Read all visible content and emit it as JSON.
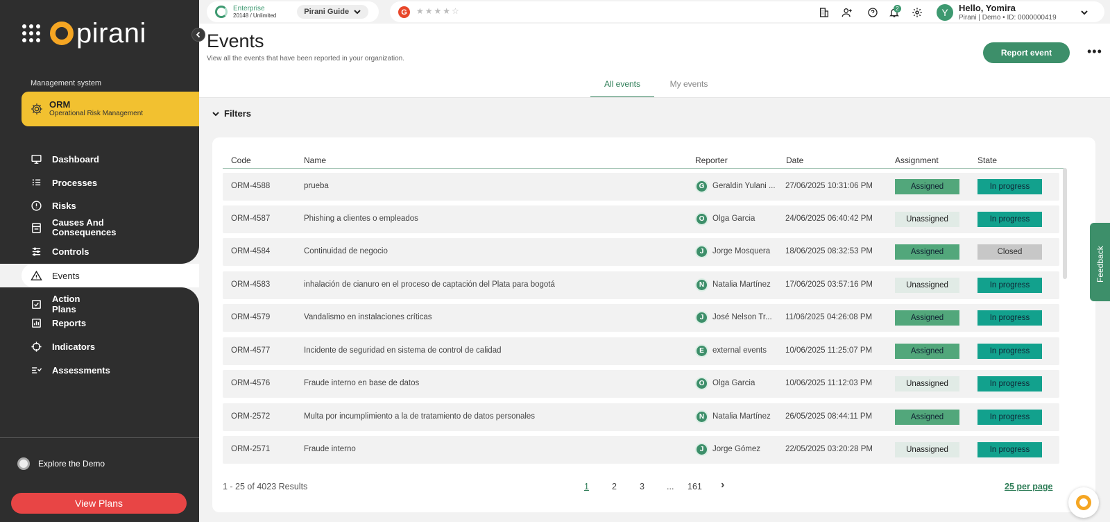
{
  "sidebar": {
    "logo_text": "pirani",
    "management_label": "Management system",
    "orm_title": "ORM",
    "orm_subtitle": "Operational Risk Management",
    "items": [
      {
        "label": "Dashboard"
      },
      {
        "label": "Processes"
      },
      {
        "label": "Risks"
      },
      {
        "label": "Causes And Consequences"
      },
      {
        "label": "Controls"
      },
      {
        "label": "Events"
      },
      {
        "label": "Action Plans"
      },
      {
        "label": "Reports"
      },
      {
        "label": "Indicators"
      },
      {
        "label": "Assessments"
      }
    ],
    "explore": "Explore the Demo",
    "view_plans": "View Plans"
  },
  "topbar": {
    "plan_title": "Enterprise",
    "plan_sub": "20148 / Unlimited",
    "guide": "Pirani Guide",
    "g_letter": "G",
    "stars": "★★★★☆",
    "notifications": "2",
    "avatar": "Y",
    "hello": "Hello, Yomira",
    "hello_sub": "Pirani | Demo • ID: 0000000419"
  },
  "page": {
    "title": "Events",
    "subtitle": "View all the events that have been reported in your organization.",
    "report_button": "Report event",
    "more": "•••",
    "tabs": [
      {
        "label": "All events"
      },
      {
        "label": "My events"
      }
    ],
    "filters": "Filters"
  },
  "table": {
    "headers": [
      "Code",
      "Name",
      "Reporter",
      "Date",
      "Assignment",
      "State"
    ],
    "rows": [
      {
        "code": "ORM-4588",
        "name": "prueba",
        "initial": "G",
        "reporter": "Geraldin Yulani ...",
        "date": "27/06/2025 10:31:06 PM",
        "assignment": "Assigned",
        "state": "In progress"
      },
      {
        "code": "ORM-4587",
        "name": "Phishing a clientes o empleados",
        "initial": "O",
        "reporter": "Olga Garcia",
        "date": "24/06/2025 06:40:42 PM",
        "assignment": "Unassigned",
        "state": "In progress"
      },
      {
        "code": "ORM-4584",
        "name": "Continuidad de negocio",
        "initial": "J",
        "reporter": "Jorge Mosquera",
        "date": "18/06/2025 08:32:53 PM",
        "assignment": "Assigned",
        "state": "Closed"
      },
      {
        "code": "ORM-4583",
        "name": "inhalación de cianuro en el proceso de captación del Plata para bogotá",
        "initial": "N",
        "reporter": "Natalia Martínez",
        "date": "17/06/2025 03:57:16 PM",
        "assignment": "Unassigned",
        "state": "In progress"
      },
      {
        "code": "ORM-4579",
        "name": "Vandalismo en instalaciones críticas",
        "initial": "J",
        "reporter": "José Nelson Tr...",
        "date": "11/06/2025 04:26:08 PM",
        "assignment": "Assigned",
        "state": "In progress"
      },
      {
        "code": "ORM-4577",
        "name": "Incidente de seguridad en sistema de control de calidad",
        "initial": "E",
        "reporter": "external events",
        "date": "10/06/2025 11:25:07 PM",
        "assignment": "Assigned",
        "state": "In progress"
      },
      {
        "code": "ORM-4576",
        "name": "Fraude interno en base de datos",
        "initial": "O",
        "reporter": "Olga Garcia",
        "date": "10/06/2025 11:12:03 PM",
        "assignment": "Unassigned",
        "state": "In progress"
      },
      {
        "code": "ORM-2572",
        "name": "Multa por incumplimiento a la de tratamiento de datos personales",
        "initial": "N",
        "reporter": "Natalia Martínez",
        "date": "26/05/2025 08:44:11 PM",
        "assignment": "Assigned",
        "state": "In progress"
      },
      {
        "code": "ORM-2571",
        "name": "Fraude interno",
        "initial": "J",
        "reporter": "Jorge Gómez",
        "date": "22/05/2025 03:20:28 PM",
        "assignment": "Unassigned",
        "state": "In progress"
      }
    ],
    "results": "1 - 25 of 4023 Results",
    "pages": [
      "1",
      "2",
      "3",
      "...",
      "161"
    ],
    "next": "›",
    "per_page": "25 per page"
  },
  "feedback": "Feedback",
  "colors": {
    "brand_green": "#3d8f6a",
    "accent_yellow": "#f2c130",
    "danger_red": "#e84545",
    "sidebar_dark": "#2e2e2e"
  }
}
